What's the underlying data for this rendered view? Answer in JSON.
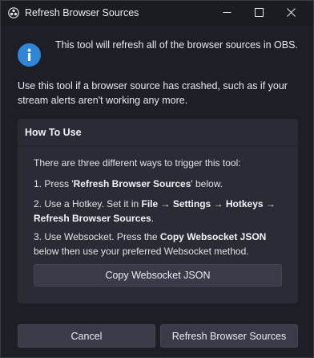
{
  "window": {
    "title": "Refresh Browser Sources"
  },
  "icons": {
    "app": "obs-logo-icon",
    "info": "info-icon",
    "minimize": "minimize-icon",
    "maximize": "maximize-icon",
    "close": "close-icon"
  },
  "colors": {
    "background": "#1e1e26",
    "panel": "#2a2b35",
    "button": "#3a3b48",
    "info_accent": "#2f86d8",
    "text": "#e9e9ee"
  },
  "intro": "This tool will refresh all of the browser sources in OBS.",
  "description": "Use this tool if a browser source has crashed, such as if your stream alerts aren't working any more.",
  "how_to": {
    "title": "How To Use",
    "intro": "There are three different ways to trigger this tool:",
    "step1": {
      "prefix": "1. Press '",
      "bold": "Refresh Browser Sources",
      "suffix": "' below."
    },
    "step2": {
      "prefix": "2. Use a Hotkey. Set it in ",
      "bold1": "File",
      "arrow1": " → ",
      "bold2": "Settings",
      "arrow2": " → ",
      "bold3": "Hotkeys",
      "arrow3": " → ",
      "bold4": "Refresh Browser Sources",
      "suffix": "."
    },
    "step3": {
      "prefix": "3. Use Websocket. Press the ",
      "bold": "Copy Websocket JSON",
      "suffix": " below then use your preferred Websocket method."
    },
    "copy_button": "Copy Websocket JSON"
  },
  "buttons": {
    "cancel": "Cancel",
    "refresh": "Refresh Browser Sources"
  }
}
